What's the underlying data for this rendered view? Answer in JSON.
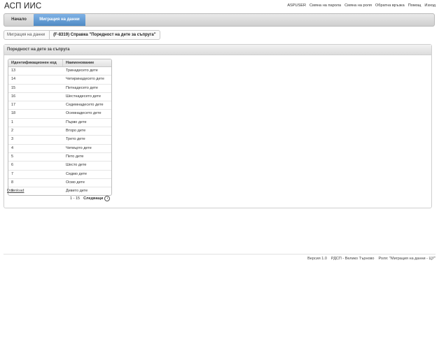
{
  "app": {
    "title": "АСП ИИС"
  },
  "top_links": [
    "ASPUSER",
    "Смяна на парола",
    "Смяна на роля",
    "Обратна връзка",
    "Помощ",
    "Изход"
  ],
  "nav": {
    "home": "Начало",
    "active": "Миграция на данни"
  },
  "breadcrumb": {
    "first": "Миграция на данни",
    "current": "(F-8319) Справка \"Поредност на дете за съпруга\""
  },
  "panel": {
    "title": "Поредност на дете за съпруга"
  },
  "grid": {
    "headers": {
      "code": "Идентификационен код",
      "name": "Наименование"
    },
    "rows": [
      {
        "code": "13",
        "name": "Тринадесето дете"
      },
      {
        "code": "14",
        "name": "Четиринадесето дете"
      },
      {
        "code": "15",
        "name": "Петнадесето дете"
      },
      {
        "code": "16",
        "name": "Шестнадесето дете"
      },
      {
        "code": "17",
        "name": "Седемнадесето дете"
      },
      {
        "code": "18",
        "name": "Осемнадесето дете"
      },
      {
        "code": "1",
        "name": "Първо дете"
      },
      {
        "code": "2",
        "name": "Второ дете"
      },
      {
        "code": "3",
        "name": "Трето дете"
      },
      {
        "code": "4",
        "name": "Четвърто дете"
      },
      {
        "code": "5",
        "name": "Пето дете"
      },
      {
        "code": "6",
        "name": "Шесто дете"
      },
      {
        "code": "7",
        "name": "Седмо дете"
      },
      {
        "code": "8",
        "name": "Осмо дете"
      },
      {
        "code": "9",
        "name": "Девето дете"
      }
    ]
  },
  "download": "Download",
  "pager": {
    "range": "1 - 15",
    "next": "Следващи"
  },
  "footer": {
    "version": "Версия 1.0",
    "office": "РДСП - Велико Търново",
    "role": "Роля: \"Миграция на данни - ЦУ\""
  }
}
